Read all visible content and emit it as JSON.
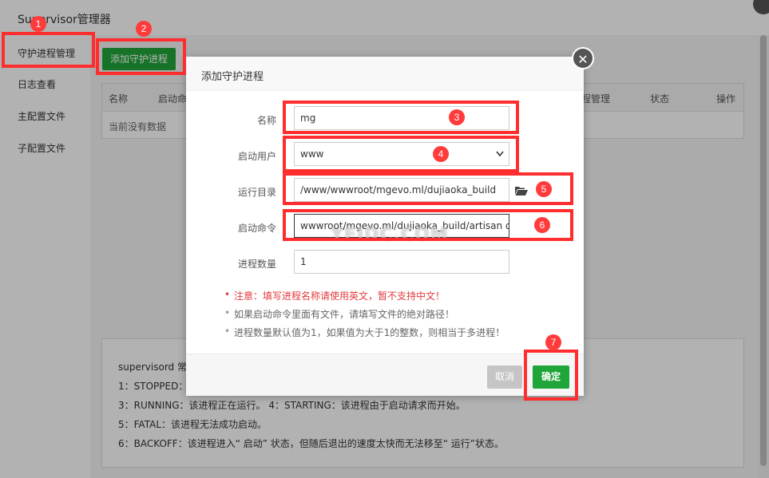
{
  "app": {
    "title": "Supervisor管理器"
  },
  "sidebar": {
    "items": [
      {
        "label": "守护进程管理"
      },
      {
        "label": "日志查看"
      },
      {
        "label": "主配置文件"
      },
      {
        "label": "子配置文件"
      }
    ]
  },
  "main": {
    "add_button": "添加守护进程",
    "table": {
      "columns": [
        "名称",
        "启动命",
        "程管理",
        "状态",
        "操作"
      ],
      "empty_text": "当前没有数据"
    },
    "info": [
      "supervisord 常",
      "1：STOPPED：",
      "3：RUNNING：该进程正在运行。 4：STARTING：该进程由于启动请求而开始。",
      "5：FATAL：该进程无法成功启动。",
      "6：BACKOFF：该进程进入“ 启动” 状态，但随后退出的速度太快而无法移至“ 运行”状态。"
    ]
  },
  "modal": {
    "title": "添加守护进程",
    "close_symbol": "✕",
    "fields": {
      "name": {
        "label": "名称",
        "value": "mg"
      },
      "user": {
        "label": "启动用户",
        "value": "www"
      },
      "dir": {
        "label": "运行目录",
        "value": "/www/wwwroot/mgevo.ml/dujiaoka_build"
      },
      "cmd": {
        "label": "启动命令",
        "value": "wwwroot/mgevo.ml/dujiaoka_build/artisan qu"
      },
      "count": {
        "label": "进程数量",
        "value": "1"
      }
    },
    "notes": [
      "注意：填写进程名称请使用英文，暂不支持中文！",
      "如果启动命令里面有文件，请填写文件的绝对路径！",
      "进程数量默认值为1，如果值为大于1的整数，则相当于多进程！"
    ],
    "cancel": "取消",
    "confirm": "确定"
  },
  "annotations": [
    "1",
    "2",
    "3",
    "4",
    "5",
    "6",
    "7"
  ],
  "watermark": "YEIDC.COM",
  "colors": {
    "primary_green": "#20a53a",
    "annotation_red": "#ff2d2d",
    "note_red": "#e4393c"
  },
  "icons": {
    "folder": "folder-open-icon",
    "close": "close-icon",
    "dropdown": "chevron-down-icon"
  }
}
